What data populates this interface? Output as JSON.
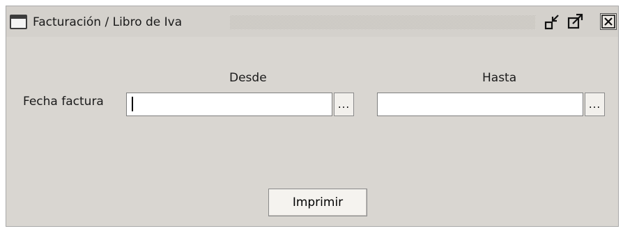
{
  "window": {
    "title": "Facturación / Libro de Iva",
    "icons": {
      "app": "window-icon",
      "restore": "restore-icon",
      "maximize": "maximize-icon",
      "close": "close-icon"
    }
  },
  "form": {
    "col_from_label": "Desde",
    "col_to_label": "Hasta",
    "row_label": "Fecha factura",
    "from_value": "",
    "to_value": "",
    "picker_label": "...",
    "print_button_label": "Imprimir"
  },
  "colors": {
    "window_bg": "#d9d6d1",
    "field_bg": "#ffffff",
    "button_bg": "#f5f3ef"
  }
}
